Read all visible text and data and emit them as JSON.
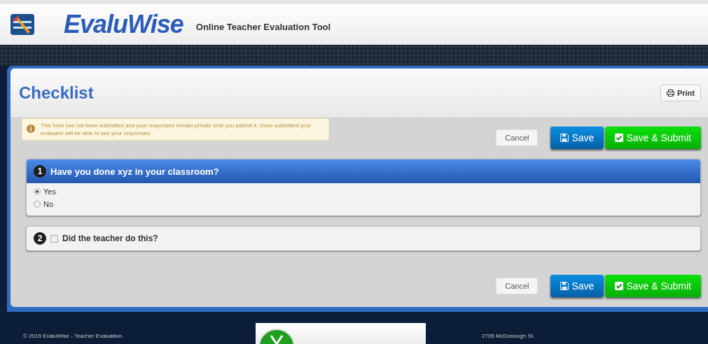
{
  "header": {
    "brand": "EvaluWise",
    "tagline": "Online Teacher Evaluation Tool"
  },
  "page": {
    "title": "Checklist",
    "print_button": "Print"
  },
  "notice": "This form has not been submitted and your responses remain private until you submit it. Once submitted your evaluator will be able to see your responses.",
  "actions_top": {
    "cancel": "Cancel",
    "save": "Save",
    "submit": "Save & Submit"
  },
  "questions": [
    {
      "number": "1",
      "kind": "radio",
      "text": "Have you done xyz in your classroom?",
      "expanded": true,
      "options": [
        {
          "label": "Yes",
          "selected": true
        },
        {
          "label": "No",
          "selected": false
        }
      ]
    },
    {
      "number": "2",
      "kind": "checkbox",
      "text": "Did the teacher do this?",
      "expanded": false,
      "checked": false
    }
  ],
  "actions_bottom": {
    "cancel": "Cancel",
    "save": "Save",
    "submit": "Save & Submit"
  },
  "footer": {
    "copyright": "© 2015 EvaluWise - Teacher Evaluation.",
    "address": "2705 McDonough St."
  }
}
